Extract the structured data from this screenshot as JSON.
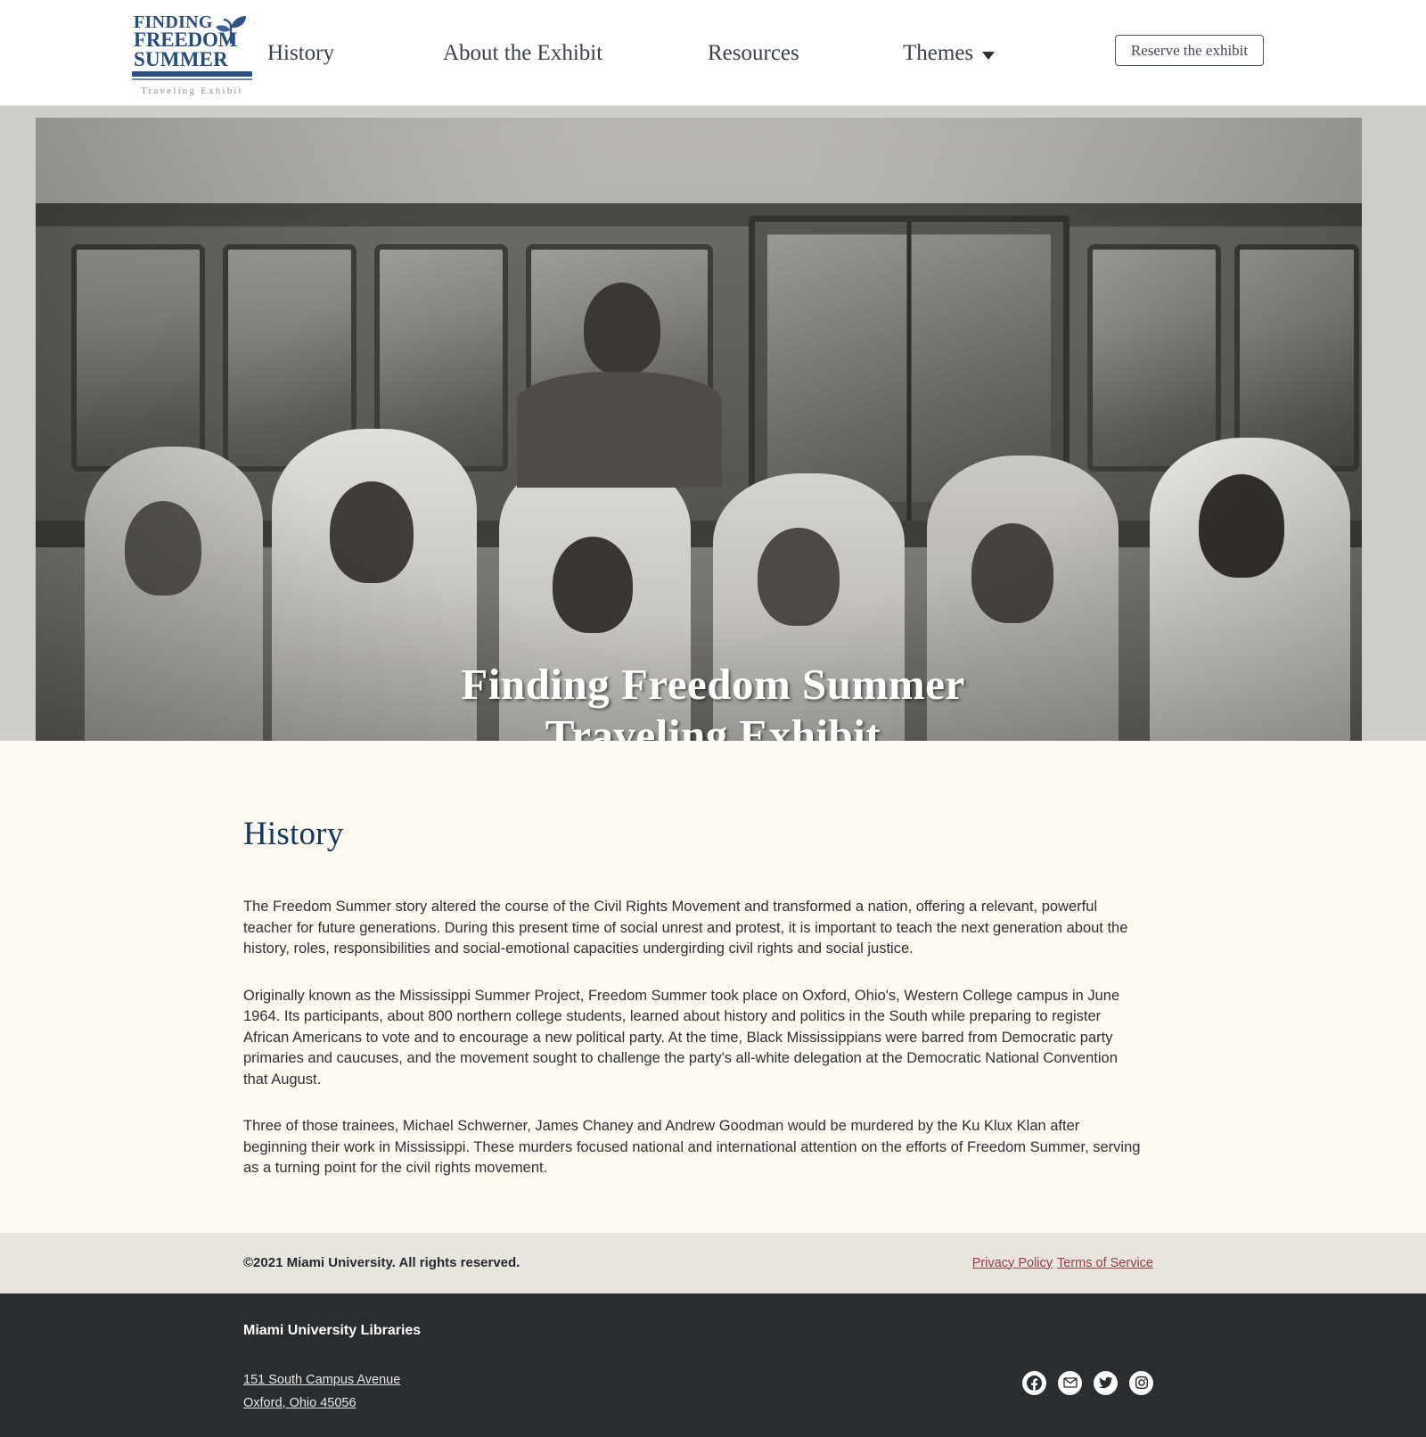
{
  "header": {
    "logo": {
      "line1": "FINDING",
      "line2": "FREEDOM",
      "line3": "SUMMER",
      "subtitle": "Traveling Exhibit",
      "icon": "sprout-icon",
      "color": "#274b7d"
    },
    "nav": [
      {
        "label": "History",
        "has_dropdown": false
      },
      {
        "label": "About the Exhibit",
        "has_dropdown": false
      },
      {
        "label": "Resources",
        "has_dropdown": false
      },
      {
        "label": "Themes",
        "has_dropdown": true
      }
    ],
    "cta": {
      "label": "Reserve the exhibit"
    }
  },
  "hero": {
    "title_line1": "Finding Freedom Summer",
    "title_line2": "Traveling Exhibit",
    "image_alt": "Black and white photograph of civil rights volunteers singing with linked arms in front of a bus"
  },
  "main": {
    "page_title": "History",
    "paragraphs": [
      "The Freedom Summer story altered the course of the Civil Rights Movement and transformed a nation, offering a relevant, powerful teacher for future generations. During this present time of social unrest and protest, it is important to teach the next generation about the history, roles, responsibilities and social-emotional capacities undergirding civil rights and social justice.",
      "Originally known as the Mississippi Summer Project, Freedom Summer took place on Oxford, Ohio's, Western College campus in June 1964. Its participants, about 800 northern college students, learned about history and politics in the South while preparing to register African Americans to vote and to encourage a new political party. At the time, Black Mississippians were barred from Democratic party primaries and caucuses, and the movement sought to challenge the party's all-white delegation at the Democratic National Convention that August.",
      "Three of those trainees, Michael Schwerner, James Chaney and Andrew Goodman would be murdered by the Ku Klux Klan after beginning their work in Mississippi. These murders focused national and international attention on the efforts of Freedom Summer, serving as a turning point for the civil rights movement."
    ]
  },
  "subfooter": {
    "copyright": "©2021 Miami University. All rights reserved.",
    "links": [
      {
        "label": "Privacy Policy"
      },
      {
        "label": "Terms of Service"
      }
    ],
    "link_color": "#9c3b43"
  },
  "footer": {
    "org": "Miami University Libraries",
    "address_line1": "151 South Campus Avenue",
    "address_line2": "Oxford, Ohio 45056",
    "socials": [
      {
        "name": "facebook-icon"
      },
      {
        "name": "email-icon"
      },
      {
        "name": "twitter-icon"
      },
      {
        "name": "instagram-icon"
      }
    ]
  }
}
